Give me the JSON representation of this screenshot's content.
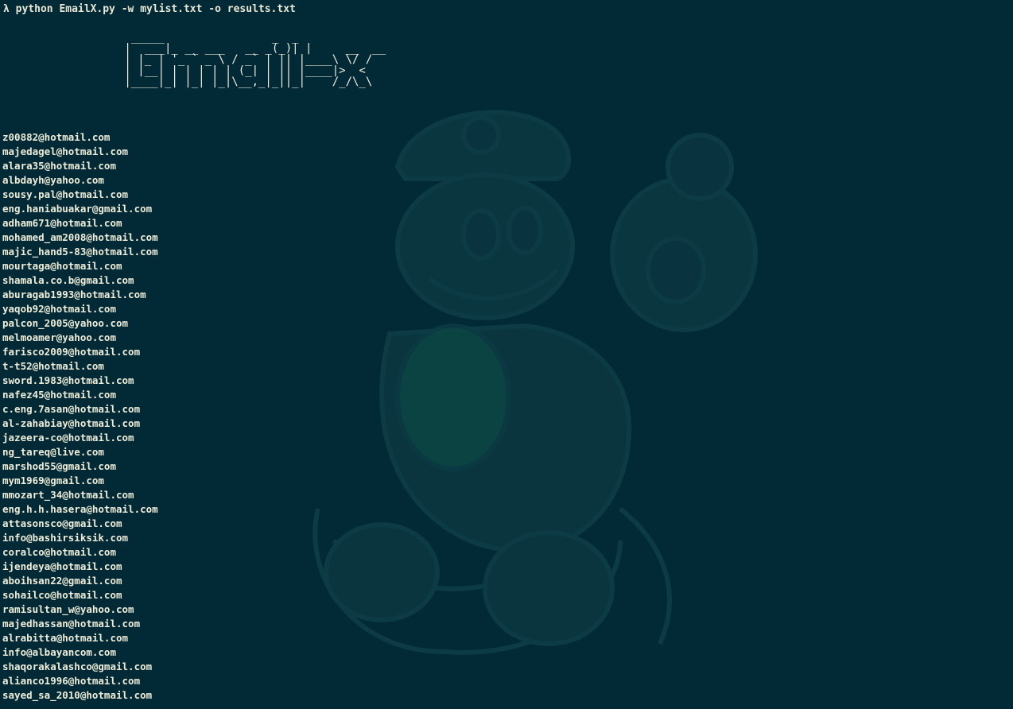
{
  "terminal": {
    "prompt_symbol": "λ",
    "command": "python EmailX.py -w mylist.txt -o results.txt",
    "banner_ascii": "  _____                _  _  \n |  ___|_ __ ___   __ _(_)| |     __  __\n | |_ | '_ ` _ \\ / _` | || |____\\ \\/ /\n | |__| | | | | | (_| | || |____|>  < \n |____|_| |_| |_|\\__,_|_||_|    /_/\\_\\",
    "colors": {
      "background": "#012a36",
      "text": "#efedd9",
      "wallpaper_tint": "#0e3a44"
    },
    "wallpaper_icon": "mario-luigi-wallpaper-icon",
    "emails": [
      "z00882@hotmail.com",
      "majedagel@hotmail.com",
      "alara35@hotmail.com",
      "albdayh@yahoo.com",
      "sousy.pal@hotmail.com",
      "eng.haniabuakar@gmail.com",
      "adham671@hotmail.com",
      "mohamed_am2008@hotmail.com",
      "majic_hand5-83@hotmail.com",
      "mourtaga@hotmail.com",
      "shamala.co.b@gmail.com",
      "aburagab1993@hotmail.com",
      "yaqob92@hotmail.com",
      "palcon_2005@yahoo.com",
      "melmoamer@yahoo.com",
      "farisco2009@hotmail.com",
      "t-t52@hotmail.com",
      "sword.1983@hotmail.com",
      "nafez45@hotmail.com",
      "c.eng.7asan@hotmail.com",
      "al-zahabiay@hotmail.com",
      "jazeera-co@hotmail.com",
      "ng_tareq@live.com",
      "marshod55@gmail.com",
      "mym1969@gmail.com",
      "mmozart_34@hotmail.com",
      "eng.h.h.hasera@hotmail.com",
      "attasonsco@gmail.com",
      "info@bashirsiksik.com",
      "coralco@hotmail.com",
      "ijendeya@hotmail.com",
      "aboihsan22@gmail.com",
      "sohailco@hotmail.com",
      "ramisultan_w@yahoo.com",
      "majedhassan@hotmail.com",
      "alrabitta@hotmail.com",
      "info@albayancom.com",
      "shaqorakalashco@gmail.com",
      "alianco1996@hotmail.com",
      "sayed_sa_2010@hotmail.com"
    ]
  }
}
